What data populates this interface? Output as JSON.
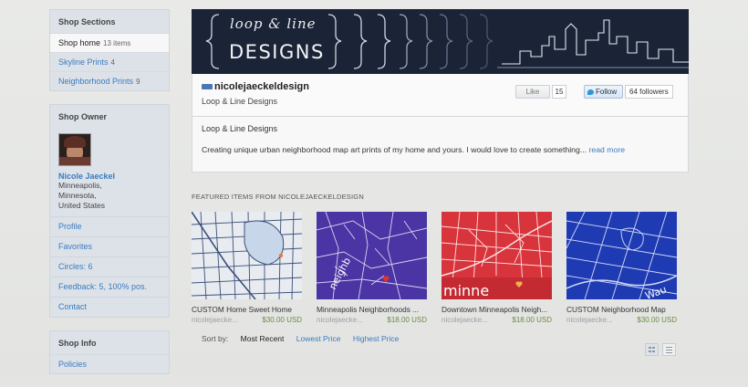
{
  "sidebar": {
    "sections_title": "Shop Sections",
    "sections": [
      {
        "label": "Shop home",
        "count": "13 items"
      },
      {
        "label": "Skyline Prints",
        "count": "4"
      },
      {
        "label": "Neighborhood Prints",
        "count": "9"
      }
    ],
    "owner_title": "Shop Owner",
    "owner_name": "Nicole Jaeckel",
    "owner_location": [
      "Minneapolis,",
      "Minnesota,",
      "United States"
    ],
    "owner_links": [
      "Profile",
      "Favorites",
      "Circles: 6",
      "Feedback: 5, 100% pos.",
      "Contact"
    ],
    "info_title": "Shop Info",
    "info_links": [
      "Policies"
    ]
  },
  "banner": {
    "brand_top": "loop & line",
    "brand_bottom": "DESIGNS"
  },
  "shop": {
    "name": "nicolejaeckeldesign",
    "subtitle": "Loop & Line Designs",
    "like_label": "Like",
    "like_count": "15",
    "follow_label": "Follow",
    "followers": "64 followers",
    "about_title": "Loop & Line Designs",
    "about_text": "Creating unique urban neighborhood map art prints of my home and yours. I would love to create something...",
    "read_more": "read more"
  },
  "featured": {
    "title": "FEATURED ITEMS FROM NICOLEJAECKELDESIGN",
    "items": [
      {
        "name": "CUSTOM Home Sweet Home",
        "shop": "nicolejaecke...",
        "price": "$30.00 USD"
      },
      {
        "name": "Minneapolis Neighborhoods ...",
        "shop": "nicolejaecke...",
        "price": "$18.00 USD"
      },
      {
        "name": "Downtown Minneapolis Neigh...",
        "shop": "nicolejaecke...",
        "price": "$18.00 USD"
      },
      {
        "name": "CUSTOM Neighborhood Map",
        "shop": "nicolejaecke...",
        "price": "$30.00 USD"
      }
    ],
    "map_texts": [
      "neighb",
      "minne",
      "Wau"
    ]
  },
  "sort": {
    "label": "Sort by:",
    "options": [
      "Most Recent",
      "Lowest Price",
      "Highest Price"
    ]
  },
  "colors": {
    "banner_bg": "#1b2336",
    "link": "#3b7bbf",
    "price": "#6a8d3e",
    "thumb2": "#4b34a3",
    "thumb3": "#d8343c",
    "thumb4": "#1f3bb3"
  },
  "icons": [
    "shop-logo-icon",
    "twitter-bird-icon",
    "grid-view-icon",
    "list-view-icon",
    "heart-icon"
  ]
}
